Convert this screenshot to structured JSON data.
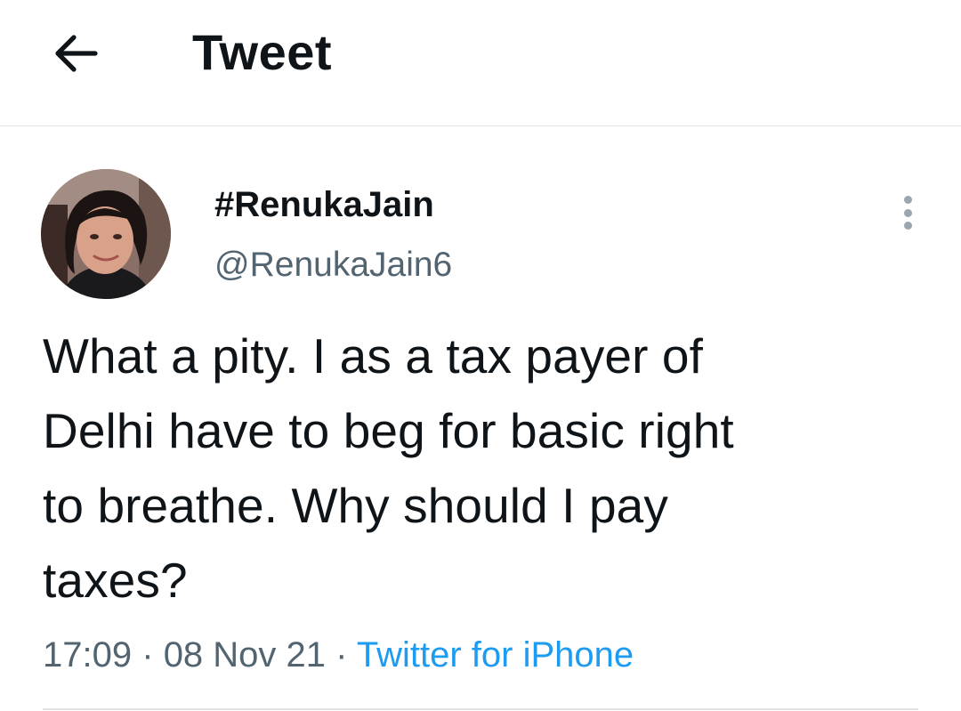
{
  "header": {
    "title": "Tweet",
    "back_icon": "arrow-left-icon"
  },
  "tweet": {
    "author": {
      "display_name": "#RenukaJain",
      "handle": "@RenukaJain6"
    },
    "more_icon": "more-vertical-icon",
    "text": "What a pity. I as a tax payer of\nDelhi have to beg for basic right\nto breathe. Why should I pay\ntaxes?",
    "time": "17:09",
    "separator": "·",
    "date": "08 Nov 21",
    "source": "Twitter for iPhone"
  },
  "colors": {
    "text": "#0f1419",
    "secondary": "#536471",
    "link": "#1d9bf0",
    "divider": "#e1e5e8"
  }
}
